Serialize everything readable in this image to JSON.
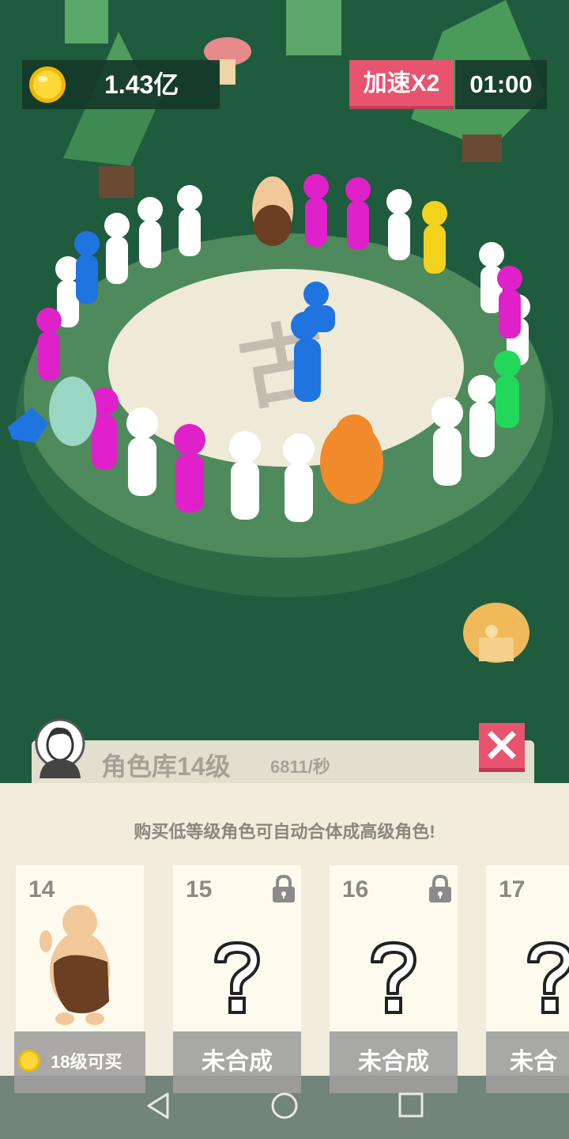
{
  "hud": {
    "coins": "1.43亿",
    "speed_label": "加速X2",
    "timer": "01:00"
  },
  "panel": {
    "title": "角色库14级",
    "rate": "6811/秒",
    "hint": "购买低等级角色可自动合体成高级角色!",
    "cards": [
      {
        "level": "14",
        "footer": "18级可买",
        "locked": false
      },
      {
        "level": "15",
        "footer": "未合成",
        "locked": true
      },
      {
        "level": "16",
        "footer": "未合成",
        "locked": true
      },
      {
        "level": "17",
        "footer": "未合",
        "locked": false
      }
    ]
  },
  "icons": {
    "coin": "coin-icon",
    "close": "close-icon",
    "lock": "lock-icon",
    "question": "question-mark-icon",
    "avatar": "avatar-icon",
    "nav_back": "back-triangle-icon",
    "nav_home": "home-circle-icon",
    "nav_recent": "recent-square-icon"
  },
  "colors": {
    "background": "#1f5b3d",
    "accent": "#e8536f",
    "panel": "#f1ecdb"
  }
}
